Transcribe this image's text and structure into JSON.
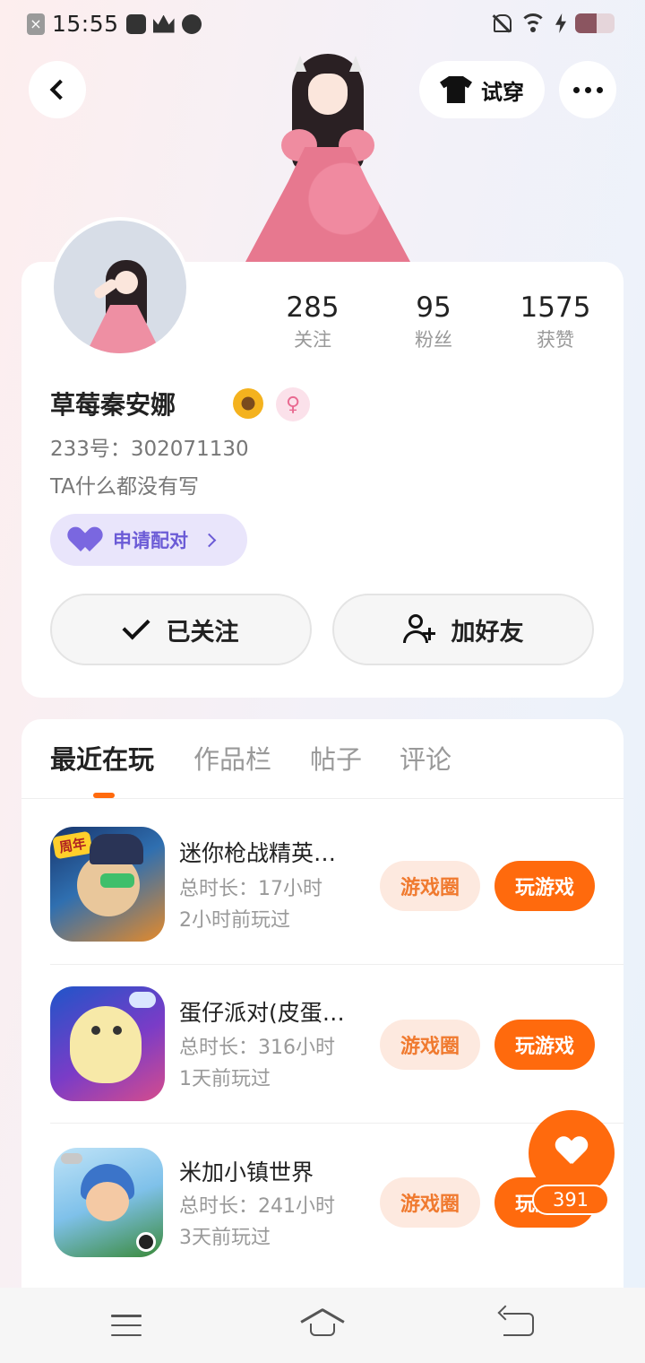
{
  "status_bar": {
    "time": "15:55"
  },
  "header": {
    "tryon_label": "试穿"
  },
  "profile": {
    "stats": [
      {
        "value": "285",
        "label": "关注"
      },
      {
        "value": "95",
        "label": "粉丝"
      },
      {
        "value": "1575",
        "label": "获赞"
      }
    ],
    "username": "草莓秦安娜",
    "gender_symbol": "♀",
    "uid": "233号：302071130",
    "bio": "TA什么都没有写",
    "pair_label": "申请配对",
    "follow_label": "已关注",
    "add_friend_label": "加好友"
  },
  "tabs": [
    {
      "label": "最近在玩"
    },
    {
      "label": "作品栏"
    },
    {
      "label": "帖子"
    },
    {
      "label": "评论"
    }
  ],
  "games": [
    {
      "title": "迷你枪战精英…",
      "duration": "总时长：17小时",
      "last_played": "2小时前玩过",
      "icon_tag": "周年",
      "circle_label": "游戏圈",
      "play_label": "玩游戏"
    },
    {
      "title": "蛋仔派对(皮蛋…",
      "duration": "总时长：316小时",
      "last_played": "1天前玩过",
      "circle_label": "游戏圈",
      "play_label": "玩游戏"
    },
    {
      "title": "米加小镇世界",
      "duration": "总时长：241小时",
      "last_played": "3天前玩过",
      "circle_label": "游戏圈",
      "play_label": "玩游戏"
    }
  ],
  "like": {
    "count": "391"
  },
  "colors": {
    "accent": "#ff6a0d",
    "pair_accent": "#6b5bd6"
  }
}
